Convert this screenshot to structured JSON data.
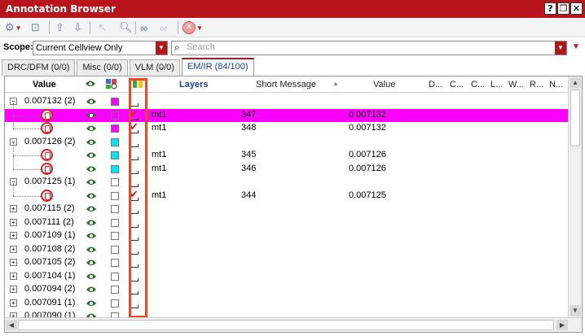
{
  "window": {
    "title": "Annotation Browser",
    "buttons": [
      "?",
      "❐",
      "✕"
    ]
  },
  "scope": {
    "label": "Scope:",
    "value": "Current Cellview Only"
  },
  "search": {
    "placeholder": "Search"
  },
  "tabs": [
    {
      "label": "DRC/DFM (0/0)",
      "active": false
    },
    {
      "label": "Misc (0/0)",
      "active": false
    },
    {
      "label": "VLM (0/0)",
      "active": false
    },
    {
      "label": "EM/IR (84/100)",
      "active": true
    }
  ],
  "columns": {
    "value": "Value",
    "layers": "Layers",
    "short_message": "Short Message",
    "value2": "Value",
    "narrow": [
      "D...",
      "C...",
      "C...",
      "L...",
      "W...",
      "R...",
      "N..."
    ]
  },
  "rows": [
    {
      "type": "group",
      "label": "0.007132 (2)",
      "expanded": true,
      "color": "#ff00ff"
    },
    {
      "type": "child",
      "layer": "mt1",
      "message": "347",
      "value": "0.007132",
      "selected": true,
      "checked": true,
      "color": "#ff00ff"
    },
    {
      "type": "child",
      "layer": "mt1",
      "message": "348",
      "value": "0.007132",
      "selected": false,
      "checked": true,
      "color": "#ff00ff"
    },
    {
      "type": "group",
      "label": "0.007126 (2)",
      "expanded": true,
      "color": "#00e5ff"
    },
    {
      "type": "child",
      "layer": "mt1",
      "message": "345",
      "value": "0.007126",
      "selected": false,
      "checked": false,
      "color": "#00e5ff"
    },
    {
      "type": "child",
      "layer": "mt1",
      "message": "346",
      "value": "0.007126",
      "selected": false,
      "checked": false,
      "color": "#00e5ff"
    },
    {
      "type": "group",
      "label": "0.007125 (1)",
      "expanded": true,
      "color": "#ffffff"
    },
    {
      "type": "child",
      "layer": "mt1",
      "message": "344",
      "value": "0.007125",
      "selected": false,
      "checked": true,
      "color": "#ffffff"
    },
    {
      "type": "group",
      "label": "0.007115 (2)",
      "expanded": false,
      "color": "#ffffff"
    },
    {
      "type": "group",
      "label": "0.007111 (2)",
      "expanded": false,
      "color": "#ffffff"
    },
    {
      "type": "group",
      "label": "0.007109 (1)",
      "expanded": false,
      "color": "#ffffff"
    },
    {
      "type": "group",
      "label": "0.007108 (2)",
      "expanded": false,
      "color": "#ffffff"
    },
    {
      "type": "group",
      "label": "0.007105 (2)",
      "expanded": false,
      "color": "#ffffff"
    },
    {
      "type": "group",
      "label": "0.007104 (1)",
      "expanded": false,
      "color": "#ffffff"
    },
    {
      "type": "group",
      "label": "0.007094 (2)",
      "expanded": false,
      "color": "#ffffff"
    },
    {
      "type": "group",
      "label": "0.007091 (1)",
      "expanded": false,
      "color": "#ffffff"
    },
    {
      "type": "group",
      "label": "0.007090 (1)",
      "expanded": false,
      "color": "#ffffff"
    }
  ],
  "colors": {
    "accent": "#b8141b",
    "selection": "#ff00ff",
    "highlight": "#ea4b24"
  }
}
